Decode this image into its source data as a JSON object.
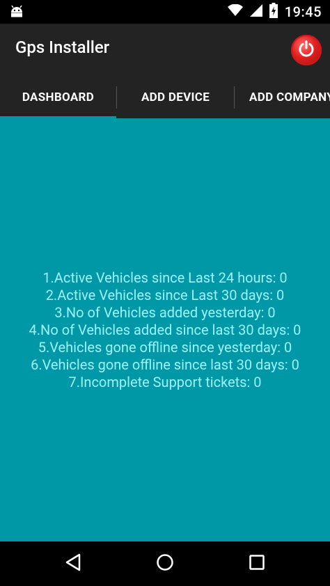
{
  "status_bar": {
    "time": "19:45",
    "icons": [
      "android-icon",
      "wifi-icon",
      "signal-icon",
      "battery-charging-icon"
    ]
  },
  "app_bar": {
    "title": "Gps Installer",
    "power_icon": "power-icon"
  },
  "tabs": [
    {
      "label": "DASHBOARD",
      "selected": true
    },
    {
      "label": "ADD DEVICE",
      "selected": false
    },
    {
      "label": "ADD COMPANY",
      "selected": false
    }
  ],
  "dashboard": {
    "stats": [
      "1.Active Vehicles since Last 24 hours: 0",
      "2.Active Vehicles since Last 30 days: 0",
      "3.No of Vehicles added yesterday: 0",
      "4.No of Vehicles added since last 30 days: 0",
      "5.Vehicles gone offline since yesterday: 0",
      "6.Vehicles gone offline since last 30 days: 0",
      "7.Incomplete Support tickets: 0"
    ]
  },
  "nav_bar": {
    "icons": [
      "back-icon",
      "home-icon",
      "recents-icon"
    ]
  },
  "colors": {
    "app_bar": "#232323",
    "content_bg": "#0097a7",
    "stat_text": "#9ef3ff",
    "tab_indicator": "#0097a7",
    "power_button": "#e02020"
  }
}
